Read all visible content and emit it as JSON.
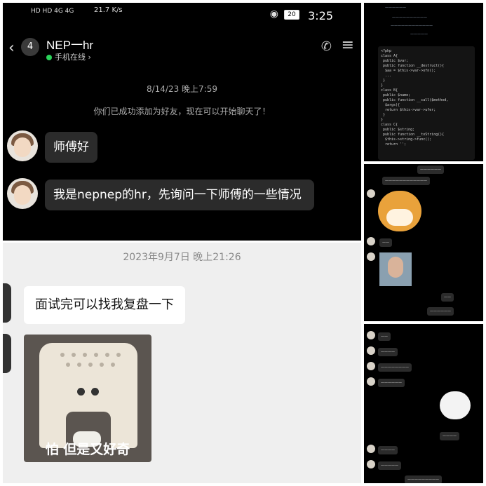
{
  "panelA": {
    "statusbar": {
      "left_icons": "HD HD 4G 4G",
      "speed": "21.7 K/s",
      "battery": "20",
      "time": "3:25"
    },
    "header": {
      "back_count": "4",
      "title": "NEP一hr",
      "online": "手机在线",
      "online_chevron": "›"
    },
    "timestamp": "8/14/23 晚上7:59",
    "system_note": "你们已成功添加为好友，现在可以开始聊天了！",
    "messages": [
      {
        "text": "师傅好"
      },
      {
        "text": "我是nepnep的hr，先询问一下师傅的一些情况"
      }
    ]
  },
  "panelB": {
    "timestamp": "2023年9月7日 晚上21:26",
    "messages": [
      {
        "text": "面试完可以找我复盘一下"
      }
    ],
    "sticker_caption": "怕 但是又好奇"
  },
  "panelC": {
    "lines": [
      "——————",
      "——————————",
      "————————————",
      "—————"
    ],
    "code": "<?php\nclass A{\n public $var;\n public function __destruct(){\n  $aa = $this->var->ofn();\n  ...\n }\n}\nclass B{\n public $name;\n public function __call($method,\n  $args){\n  return $this->var->ufer;\n }\n}\nclass C{\n public $string;\n public function __toString(){\n  $this->string->func();\n  return '';"
  },
  "panelD": {
    "bubbles": [
      "——————",
      "————————————",
      "——",
      "——",
      "——————"
    ]
  },
  "panelE": {
    "bubbles": [
      "——",
      "————",
      "————————",
      "——————",
      "————",
      "————",
      "—————",
      "—————————"
    ]
  }
}
